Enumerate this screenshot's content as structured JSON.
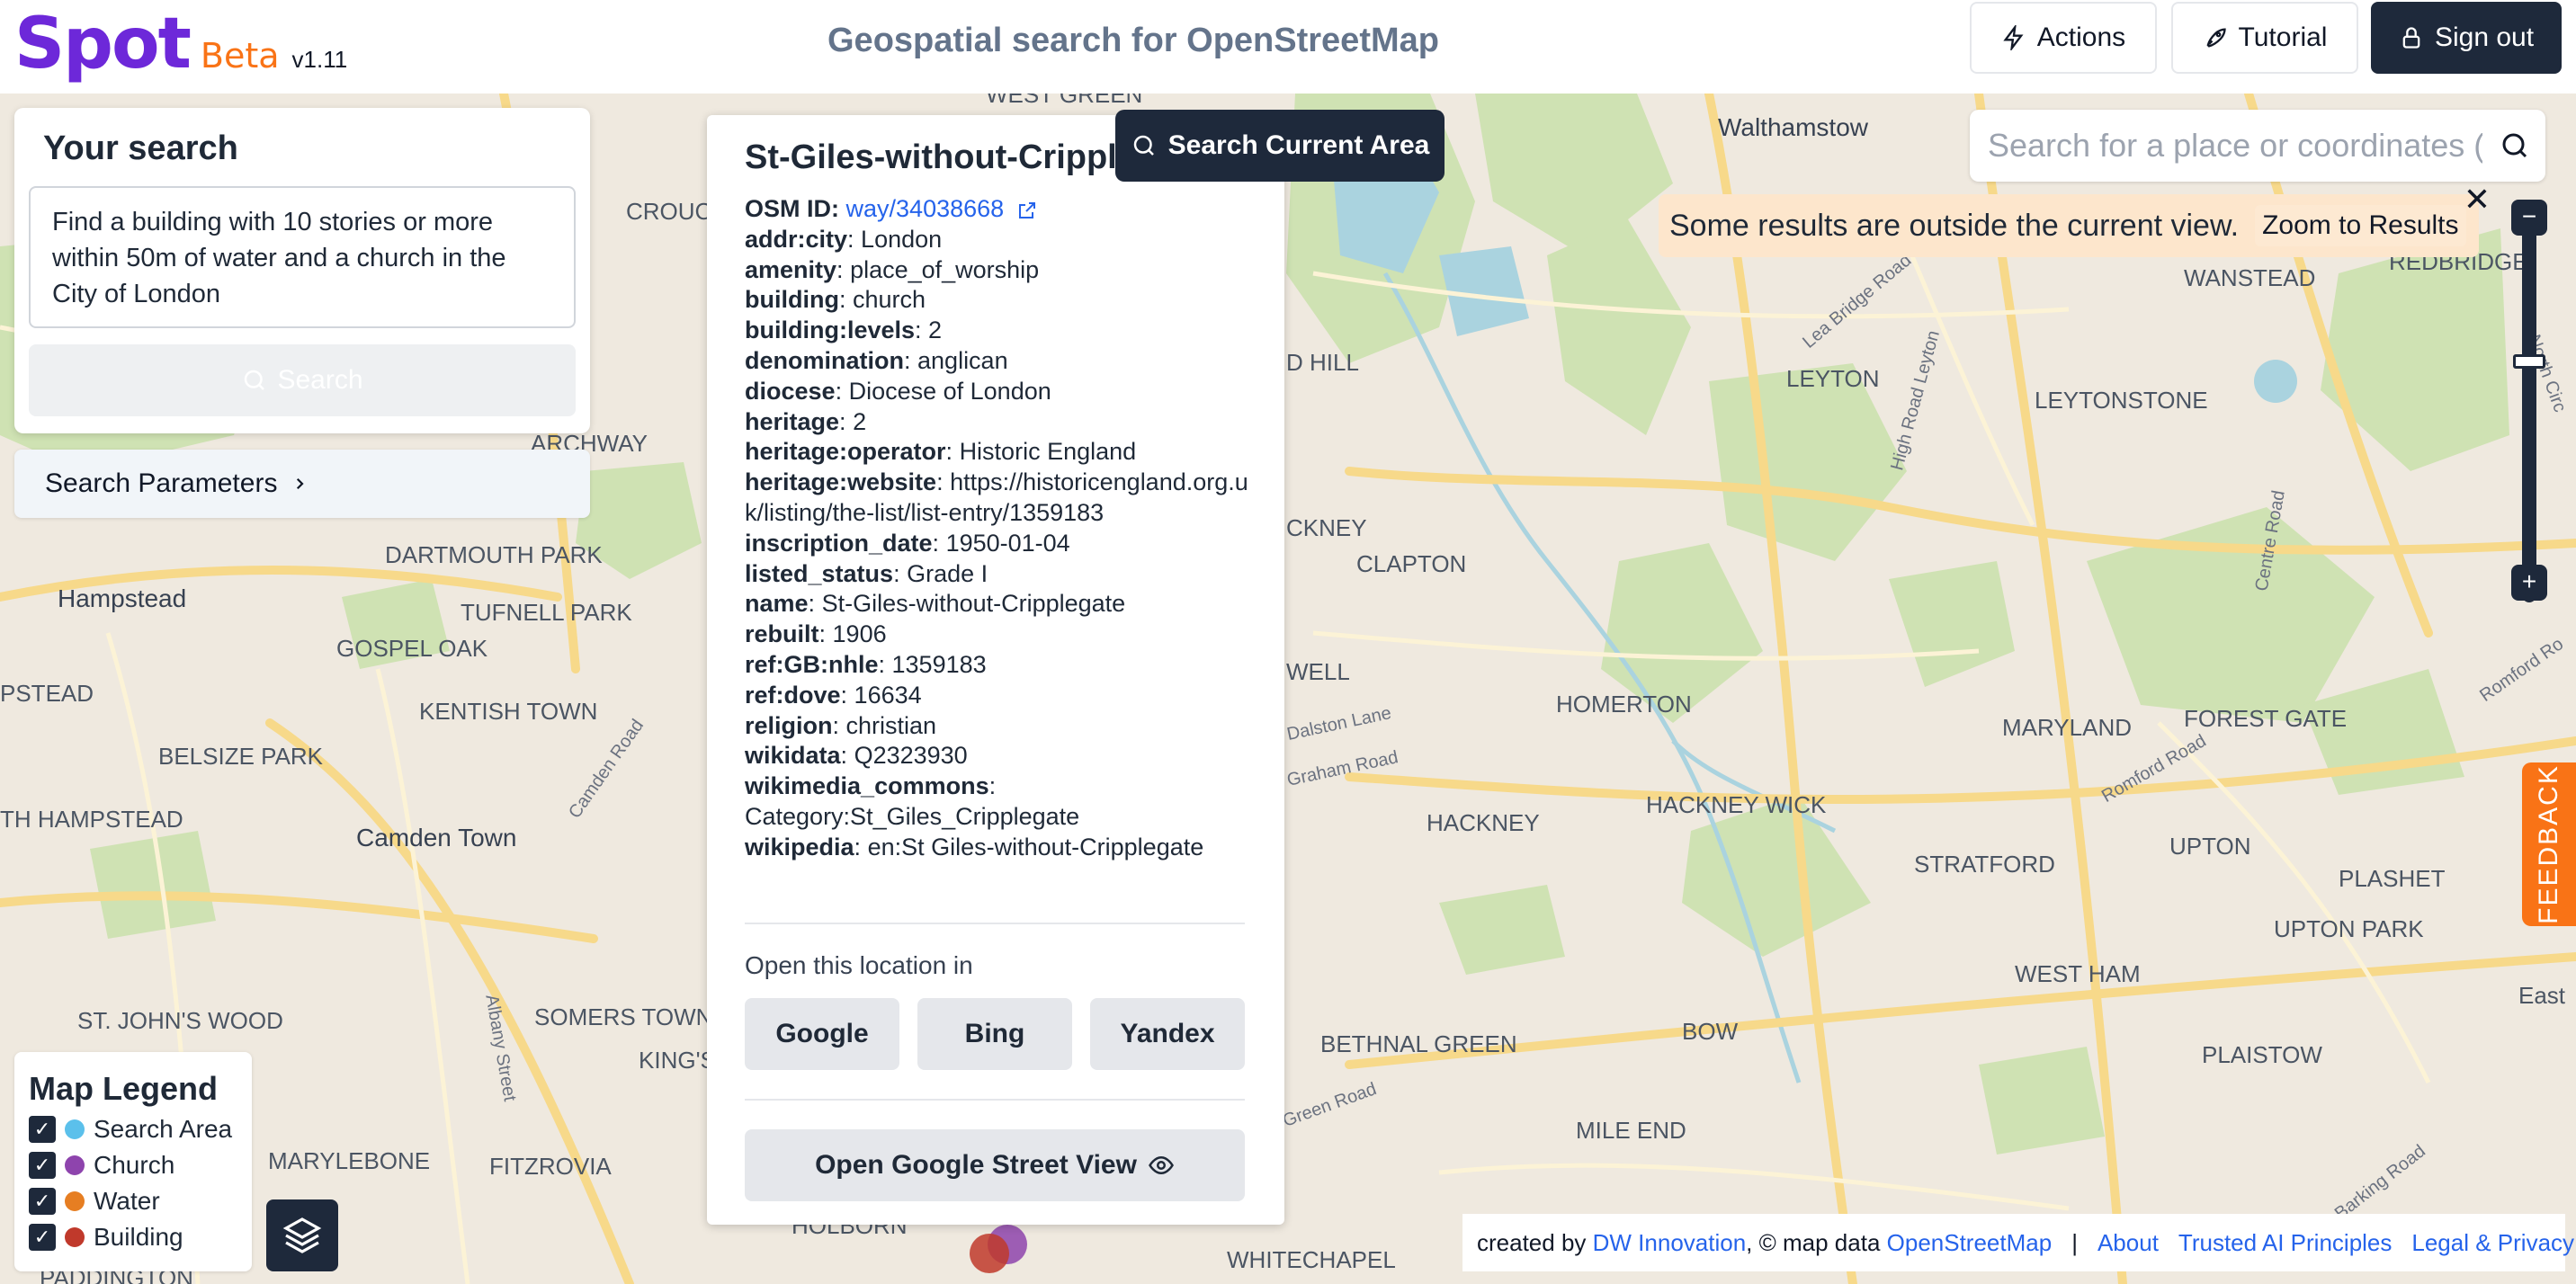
{
  "header": {
    "logo": "Spot",
    "beta": "Beta",
    "version": "v1.11",
    "title": "Geospatial search for OpenStreetMap",
    "actions_label": "Actions",
    "tutorial_label": "Tutorial",
    "signout_label": "Sign out"
  },
  "search_panel": {
    "title": "Your search",
    "query": "Find a building with 10 stories or more within 50m of water and a church in the City of London",
    "search_label": "Search",
    "params_label": "Search Parameters"
  },
  "popup": {
    "title": "St-Giles-without-Cripplegate",
    "osm_id_key": "OSM ID",
    "osm_id_value": "way/34038668",
    "properties": [
      {
        "key": "addr:city",
        "value": "London"
      },
      {
        "key": "amenity",
        "value": "place_of_worship"
      },
      {
        "key": "building",
        "value": "church"
      },
      {
        "key": "building:levels",
        "value": "2"
      },
      {
        "key": "denomination",
        "value": "anglican"
      },
      {
        "key": "diocese",
        "value": "Diocese of London"
      },
      {
        "key": "heritage",
        "value": "2"
      },
      {
        "key": "heritage:operator",
        "value": "Historic England"
      },
      {
        "key": "heritage:website",
        "value": "https://historicengland.org.uk/listing/the-list/list-entry/1359183"
      },
      {
        "key": "inscription_date",
        "value": "1950-01-04"
      },
      {
        "key": "listed_status",
        "value": "Grade I"
      },
      {
        "key": "name",
        "value": "St-Giles-without-Cripplegate"
      },
      {
        "key": "rebuilt",
        "value": "1906"
      },
      {
        "key": "ref:GB:nhle",
        "value": "1359183"
      },
      {
        "key": "ref:dove",
        "value": "16634"
      },
      {
        "key": "religion",
        "value": "christian"
      },
      {
        "key": "wikidata",
        "value": "Q2323930"
      },
      {
        "key": "wikimedia_commons",
        "value": "Category:St_Giles_Cripplegate"
      },
      {
        "key": "wikipedia",
        "value": "en:St Giles-without-Cripplegate"
      }
    ],
    "open_in_label": "Open this location in",
    "engines": [
      "Google",
      "Bing",
      "Yandex"
    ],
    "street_view_label": "Open Google Street View"
  },
  "map": {
    "search_area_label": "Search Current Area",
    "place_search_placeholder": "Search for a place or coordinates (lat, lon)",
    "notice_text": "Some results are outside the current view.",
    "zoom_results_label": "Zoom to Results",
    "zoom_level": 0.37,
    "feedback_label": "FEEDBACK",
    "labels": [
      {
        "text": "WEST GREEN"
      },
      {
        "text": "CROUCH"
      },
      {
        "text": "Walthamstow"
      },
      {
        "text": "REDBRIDGE"
      },
      {
        "text": "WANSTEAD"
      },
      {
        "text": "D HILL"
      },
      {
        "text": "LEYTON"
      },
      {
        "text": "LEYTONSTONE"
      },
      {
        "text": "ARCHWAY"
      },
      {
        "text": "CKNEY"
      },
      {
        "text": "CLAPTON"
      },
      {
        "text": "DARTMOUTH PARK"
      },
      {
        "text": "Hampstead"
      },
      {
        "text": "TUFNELL PARK"
      },
      {
        "text": "GOSPEL OAK"
      },
      {
        "text": "PSTEAD"
      },
      {
        "text": "KENTISH TOWN"
      },
      {
        "text": "WELL"
      },
      {
        "text": "HOMERTON"
      },
      {
        "text": "MARYLAND"
      },
      {
        "text": "FOREST GATE"
      },
      {
        "text": "BELSIZE PARK"
      },
      {
        "text": "HACKNEY"
      },
      {
        "text": "HACKNEY WICK"
      },
      {
        "text": "TH HAMPSTEAD"
      },
      {
        "text": "Camden Town"
      },
      {
        "text": "STRATFORD"
      },
      {
        "text": "UPTON"
      },
      {
        "text": "PLASHET"
      },
      {
        "text": "UPTON PARK"
      },
      {
        "text": "WEST HAM"
      },
      {
        "text": "ST. JOHN'S WOOD"
      },
      {
        "text": "SOMERS TOWN"
      },
      {
        "text": "KING'S"
      },
      {
        "text": "BOW"
      },
      {
        "text": "East"
      },
      {
        "text": "BETHNAL GREEN"
      },
      {
        "text": "PLAISTOW"
      },
      {
        "text": "MARYLEBONE"
      },
      {
        "text": "FITZROVIA"
      },
      {
        "text": "MILE END"
      },
      {
        "text": "HOLBORN"
      },
      {
        "text": "WHITECHAPEL"
      },
      {
        "text": "PADDINGTON"
      }
    ],
    "road_labels": [
      {
        "text": "Lea Bridge Road"
      },
      {
        "text": "High Road Leyton"
      },
      {
        "text": "Centre Road"
      },
      {
        "text": "North Circ"
      },
      {
        "text": "Camden Road"
      },
      {
        "text": "Albany Street"
      },
      {
        "text": "Dalston Lane"
      },
      {
        "text": "Graham Road"
      },
      {
        "text": "Romford Road"
      },
      {
        "text": "Romford Ro"
      },
      {
        "text": "Green Road"
      },
      {
        "text": "Barking Road"
      }
    ]
  },
  "legend": {
    "title": "Map Legend",
    "items": [
      {
        "label": "Search Area",
        "color": "#5bc0eb"
      },
      {
        "label": "Church",
        "color": "#8e44ad"
      },
      {
        "label": "Water",
        "color": "#e67e22"
      },
      {
        "label": "Building",
        "color": "#c0392b"
      }
    ]
  },
  "footer": {
    "created_by": "created by",
    "dw": "DW Innovation",
    "map_data": ", © map data",
    "osm": "OpenStreetMap",
    "sep": "|",
    "about": "About",
    "trusted": "Trusted AI Principles",
    "legal": "Legal & Privacy"
  },
  "colors": {
    "primary": "#1e293b",
    "logo": "#6d28d9",
    "beta": "#f97316",
    "link": "#2563eb",
    "notice_bg": "#fde6cc",
    "park": "#cfe2b3",
    "water": "#aad3df"
  }
}
